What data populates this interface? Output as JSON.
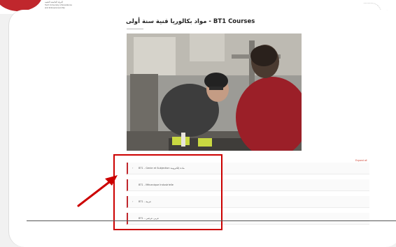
{
  "brand": {
    "line1": "الدولة الجامعة التقنية",
    "line2": "Tech University of Excellence",
    "line3": "and Entrepreneurship"
  },
  "page": {
    "title": "مواد بكالوريا قنية سنة أولى - BT1 Courses"
  },
  "expand_label": "Expand all",
  "courses": [
    {
      "label": "BT1 - Genie et Subjection مادة إلكترونية"
    },
    {
      "label": "BT1 - Mécanique Industrielle"
    },
    {
      "label": "BT1 - عربية"
    },
    {
      "label": "BT1 - عربي عرضي"
    }
  ],
  "colors": {
    "accent": "#c0272d",
    "annotation": "#cc0000",
    "link": "#d14b3c"
  }
}
